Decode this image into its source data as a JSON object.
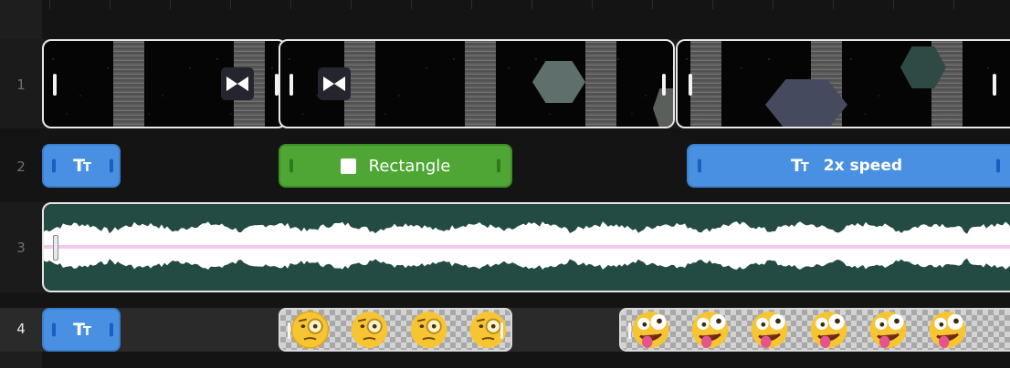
{
  "tracks": [
    {
      "number": "1",
      "type": "video",
      "active": false
    },
    {
      "number": "2",
      "type": "text",
      "active": false
    },
    {
      "number": "3",
      "type": "audio",
      "active": false
    },
    {
      "number": "4",
      "type": "text",
      "active": true
    }
  ],
  "track2": {
    "shape_clip_label": "Rectangle",
    "text_clip_label": "2x speed"
  },
  "icons": {
    "text": "text-tt-icon",
    "transition": "bowtie-transition-icon",
    "shape": "square-icon",
    "emoji_monocle": "face-with-monocle-emoji",
    "emoji_zany": "zany-face-emoji"
  },
  "colors": {
    "text_clip": "#4a90e2",
    "shape_clip": "#4fa635",
    "audio_clip": "#234b43",
    "audio_center_line": "#f5c6f0",
    "track_gutter": "#1e1e1e"
  }
}
